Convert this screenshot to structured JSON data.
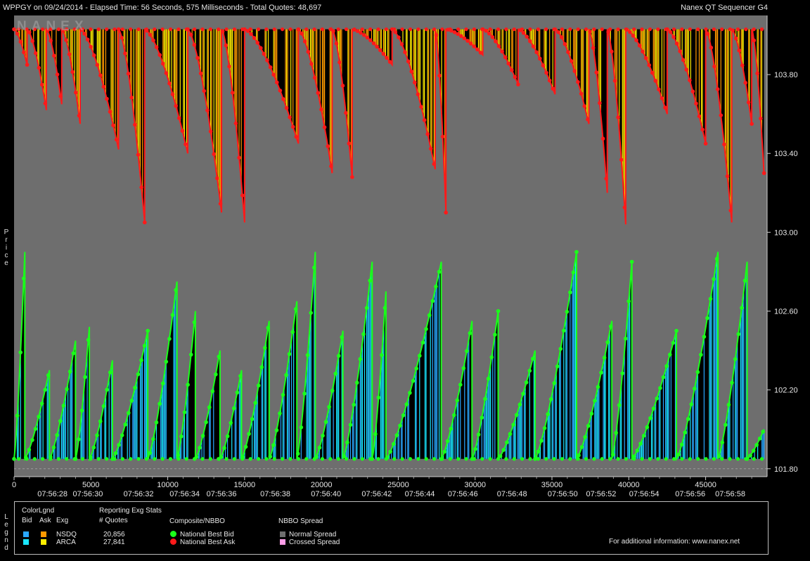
{
  "header": {
    "title": "WPPGY on 09/24/2014  -  Elapsed Time: 56 Seconds, 575 Milliseconds  -  Total Quotes: 48,697",
    "app_name": "Nanex QT Sequencer G4",
    "watermark": "NANEX"
  },
  "side_labels": {
    "price": [
      "P",
      "r",
      "i",
      "c",
      "e"
    ],
    "legend": [
      "L",
      "e",
      "g",
      "n",
      "d"
    ]
  },
  "chart_data": {
    "type": "line",
    "ylabel": "Price",
    "ylim": [
      101.76,
      104.1
    ],
    "xlim": [
      0,
      49000
    ],
    "y_ticks": [
      "103.80",
      "103.40",
      "103.00",
      "102.60",
      "102.20",
      "101.80"
    ],
    "y_tick_values": [
      103.8,
      103.4,
      103.0,
      102.6,
      102.2,
      101.8
    ],
    "x_ticks": [
      "0",
      "5000",
      "10000",
      "15000",
      "20000",
      "25000",
      "30000",
      "35000",
      "40000",
      "45000"
    ],
    "x_tick_values": [
      0,
      5000,
      10000,
      15000,
      20000,
      25000,
      30000,
      35000,
      40000,
      45000
    ],
    "time_ticks": [
      "07:56:28",
      "07:56:30",
      "07:56:32",
      "07:56:34",
      "07:56:36",
      "07:56:38",
      "07:56:40",
      "07:56:42",
      "07:56:44",
      "07:56:46",
      "07:56:48",
      "07:56:50",
      "07:56:52",
      "07:56:54",
      "07:56:56",
      "07:56:58"
    ],
    "time_tick_positions": [
      2500,
      4800,
      8100,
      11100,
      13500,
      17000,
      20300,
      23600,
      26400,
      29200,
      32400,
      35700,
      38200,
      41000,
      44000,
      46600
    ],
    "series": [
      {
        "name": "National Best Ask",
        "color": "#ff1a1a",
        "ask_ceiling": 104.03,
        "cycles": [
          {
            "x0": 0,
            "x1": 850,
            "low": 103.85
          },
          {
            "x0": 850,
            "x1": 2100,
            "low": 103.62
          },
          {
            "x0": 2100,
            "x1": 3100,
            "low": 103.65
          },
          {
            "x0": 3100,
            "x1": 4300,
            "low": 103.55
          },
          {
            "x0": 4300,
            "x1": 6800,
            "low": 103.42
          },
          {
            "x0": 6800,
            "x1": 8500,
            "low": 103.05
          },
          {
            "x0": 8500,
            "x1": 11300,
            "low": 103.4
          },
          {
            "x0": 11300,
            "x1": 13500,
            "low": 103.1
          },
          {
            "x0": 13500,
            "x1": 15000,
            "low": 103.05
          },
          {
            "x0": 15000,
            "x1": 18500,
            "low": 103.45
          },
          {
            "x0": 18500,
            "x1": 20700,
            "low": 103.3
          },
          {
            "x0": 20700,
            "x1": 22000,
            "low": 103.28
          },
          {
            "x0": 22000,
            "x1": 24600,
            "low": 103.85
          },
          {
            "x0": 24600,
            "x1": 27400,
            "low": 103.32
          },
          {
            "x0": 27400,
            "x1": 28100,
            "low": 103.1
          },
          {
            "x0": 28100,
            "x1": 30500,
            "low": 103.9
          },
          {
            "x0": 30500,
            "x1": 32800,
            "low": 103.75
          },
          {
            "x0": 32800,
            "x1": 35200,
            "low": 103.7
          },
          {
            "x0": 35200,
            "x1": 37400,
            "low": 103.55
          },
          {
            "x0": 37400,
            "x1": 38600,
            "low": 103.2
          },
          {
            "x0": 38600,
            "x1": 39800,
            "low": 103.04
          },
          {
            "x0": 39800,
            "x1": 42500,
            "low": 103.6
          },
          {
            "x0": 42500,
            "x1": 45000,
            "low": 103.45
          },
          {
            "x0": 45000,
            "x1": 46700,
            "low": 103.05
          },
          {
            "x0": 46700,
            "x1": 48000,
            "low": 103.55
          },
          {
            "x0": 48000,
            "x1": 48800,
            "low": 103.3
          }
        ]
      },
      {
        "name": "National Best Bid",
        "color": "#1aff1a",
        "bid_floor": 101.85,
        "cycles": [
          {
            "x0": 0,
            "x1": 700,
            "high": 102.9
          },
          {
            "x0": 700,
            "x1": 2300,
            "high": 102.3
          },
          {
            "x0": 2300,
            "x1": 4000,
            "high": 102.45
          },
          {
            "x0": 4000,
            "x1": 4900,
            "high": 102.52
          },
          {
            "x0": 4900,
            "x1": 6400,
            "high": 102.35
          },
          {
            "x0": 6400,
            "x1": 8700,
            "high": 102.5
          },
          {
            "x0": 8700,
            "x1": 10600,
            "high": 102.75
          },
          {
            "x0": 10600,
            "x1": 11800,
            "high": 102.6
          },
          {
            "x0": 11800,
            "x1": 13400,
            "high": 102.4
          },
          {
            "x0": 13400,
            "x1": 14800,
            "high": 102.3
          },
          {
            "x0": 14800,
            "x1": 16600,
            "high": 102.55
          },
          {
            "x0": 16600,
            "x1": 18400,
            "high": 102.65
          },
          {
            "x0": 18400,
            "x1": 19600,
            "high": 102.9
          },
          {
            "x0": 19600,
            "x1": 21400,
            "high": 102.5
          },
          {
            "x0": 21400,
            "x1": 23300,
            "high": 102.85
          },
          {
            "x0": 23300,
            "x1": 24200,
            "high": 102.7
          },
          {
            "x0": 24200,
            "x1": 27800,
            "high": 102.85
          },
          {
            "x0": 27800,
            "x1": 29800,
            "high": 102.55
          },
          {
            "x0": 29800,
            "x1": 31500,
            "high": 102.6
          },
          {
            "x0": 31500,
            "x1": 33900,
            "high": 102.4
          },
          {
            "x0": 33900,
            "x1": 36600,
            "high": 102.9
          },
          {
            "x0": 36600,
            "x1": 38900,
            "high": 102.55
          },
          {
            "x0": 38900,
            "x1": 40200,
            "high": 102.85
          },
          {
            "x0": 40200,
            "x1": 43100,
            "high": 102.5
          },
          {
            "x0": 43100,
            "x1": 45800,
            "high": 102.9
          },
          {
            "x0": 45800,
            "x1": 47700,
            "high": 102.85
          },
          {
            "x0": 47700,
            "x1": 48800,
            "high": 102.0
          }
        ]
      }
    ],
    "bar_colors": {
      "NSDQ_bid": "#2aa7ff",
      "NSDQ_ask": "#ff9a00",
      "ARCA_bid": "#19e6ff",
      "ARCA_ask": "#ffee00",
      "normal_spread": "#6e6e6e",
      "crossed_spread": "#ff9ee8"
    }
  },
  "legend": {
    "color_legend_title": "ColorLgnd",
    "col_bid": "Bid",
    "col_ask": "Ask",
    "col_exg": "Exg",
    "stats_title": "Reporting Exg Stats",
    "col_quotes": "# Quotes",
    "exchanges": [
      {
        "name": "NSDQ",
        "quotes": "20,856",
        "bid_color": "#2aa7ff",
        "ask_color": "#ff9a00"
      },
      {
        "name": "ARCA",
        "quotes": "27,841",
        "bid_color": "#19e6ff",
        "ask_color": "#ffee00"
      }
    ],
    "nbbo_title": "Composite/NBBO",
    "nbbo_items": [
      {
        "label": "National Best Bid",
        "color": "#1aff1a"
      },
      {
        "label": "National Best Ask",
        "color": "#ff1a1a"
      }
    ],
    "spread_title": "NBBO Spread",
    "spread_items": [
      {
        "label": "Normal Spread",
        "color": "#6e6e6e"
      },
      {
        "label": "Crossed Spread",
        "color": "#ff9ee8"
      }
    ],
    "footer": "For additional information: www.nanex.net"
  }
}
